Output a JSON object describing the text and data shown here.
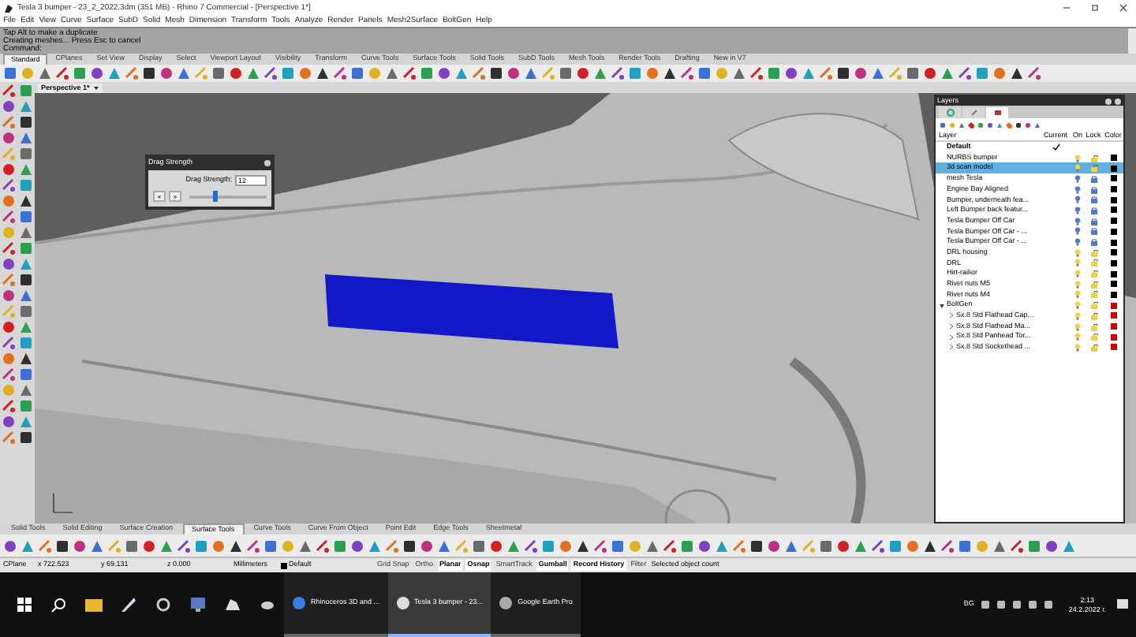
{
  "window": {
    "title": "Tesla 3 bumper - 23_2_2022.3dm (351 MB) - Rhino 7 Commercial - [Perspective 1*]"
  },
  "menu": [
    "File",
    "Edit",
    "View",
    "Curve",
    "Surface",
    "SubD",
    "Solid",
    "Mesh",
    "Dimension",
    "Transform",
    "Tools",
    "Analyze",
    "Render",
    "Panels",
    "Mesh2Surface",
    "BoltGen",
    "Help"
  ],
  "command_history": [
    "Tap Alt to make a duplicate",
    "Creating meshes... Press Esc to cancel",
    "Command:"
  ],
  "top_tabs": [
    {
      "label": "Standard",
      "selected": true
    },
    {
      "label": "CPlanes",
      "selected": false
    },
    {
      "label": "Set View",
      "selected": false
    },
    {
      "label": "Display",
      "selected": false
    },
    {
      "label": "Select",
      "selected": false
    },
    {
      "label": "Viewport Layout",
      "selected": false
    },
    {
      "label": "Visibility",
      "selected": false
    },
    {
      "label": "Transform",
      "selected": false
    },
    {
      "label": "Curve Tools",
      "selected": false
    },
    {
      "label": "Surface Tools",
      "selected": false
    },
    {
      "label": "Solid Tools",
      "selected": false
    },
    {
      "label": "SubD Tools",
      "selected": false
    },
    {
      "label": "Mesh Tools",
      "selected": false
    },
    {
      "label": "Render Tools",
      "selected": false
    },
    {
      "label": "Drafting",
      "selected": false
    },
    {
      "label": "New in V7",
      "selected": false
    }
  ],
  "viewport": {
    "title": "Perspective 1*"
  },
  "drag_dialog": {
    "title": "Drag Strength",
    "label": "Drag Strength:",
    "value": "12",
    "level": 0.3,
    "buttons": [
      "«",
      "»"
    ]
  },
  "layers_panel": {
    "title": "Layers",
    "tabs": [
      {
        "selected": false
      },
      {
        "selected": false
      },
      {
        "selected": true
      }
    ],
    "columns": [
      "Layer",
      "Current",
      "On",
      "Lock",
      "Color"
    ],
    "layers": [
      {
        "name": "Default",
        "current": true,
        "selected": false
      },
      {
        "name": "NURBS bumper",
        "current": false,
        "selected": false,
        "on": true,
        "locked": false,
        "color": "#000000"
      },
      {
        "name": "3d scan model",
        "current": false,
        "selected": true,
        "on": true,
        "locked": false,
        "color": "#000000"
      },
      {
        "name": "mesh Tesla",
        "current": false,
        "selected": false,
        "on": false,
        "locked": true,
        "color": "#000000"
      },
      {
        "name": "Engine Bay Aligned",
        "current": false,
        "selected": false,
        "on": false,
        "locked": true,
        "color": "#000000"
      },
      {
        "name": "Bumper, underneath fea...",
        "current": false,
        "selected": false,
        "on": false,
        "locked": true,
        "color": "#000000"
      },
      {
        "name": "Left Bumper back featur...",
        "current": false,
        "selected": false,
        "on": false,
        "locked": true,
        "color": "#000000"
      },
      {
        "name": "Tesla Bumper Off Car",
        "current": false,
        "selected": false,
        "on": false,
        "locked": true,
        "color": "#000000"
      },
      {
        "name": "Tesla Bumper Off Car - ...",
        "current": false,
        "selected": false,
        "on": false,
        "locked": true,
        "color": "#000000"
      },
      {
        "name": "Tesla Bumper Off Car - ...",
        "current": false,
        "selected": false,
        "on": false,
        "locked": true,
        "color": "#000000"
      },
      {
        "name": "DRL housing",
        "current": false,
        "selected": false,
        "on": true,
        "locked": false,
        "color": "#000000"
      },
      {
        "name": "DRL",
        "current": false,
        "selected": false,
        "on": true,
        "locked": false,
        "color": "#000000"
      },
      {
        "name": "Hirt-railior",
        "current": false,
        "selected": false,
        "on": true,
        "locked": false,
        "color": "#000000"
      },
      {
        "name": "Rivet nuts M5",
        "current": false,
        "selected": false,
        "on": true,
        "locked": false,
        "color": "#000000"
      },
      {
        "name": "Rivet nuts M4",
        "current": false,
        "selected": false,
        "on": true,
        "locked": false,
        "color": "#000000"
      },
      {
        "name": "BoltGen",
        "current": false,
        "selected": false,
        "on": true,
        "locked": false,
        "color": "#d40000",
        "expanded": true,
        "children": [
          {
            "name": "Sx.8 Std Flathead Cap...",
            "current": false,
            "selected": false,
            "on": true,
            "locked": false,
            "color": "#d40000",
            "expanded": false
          },
          {
            "name": "Sx.8 Std Flathead Ma...",
            "current": false,
            "selected": false,
            "on": true,
            "locked": false,
            "color": "#d40000",
            "expanded": false
          },
          {
            "name": "Sx.8 Std Panhead Tor...",
            "current": false,
            "selected": false,
            "on": true,
            "locked": false,
            "color": "#d40000",
            "expanded": false
          },
          {
            "name": "Sx.8 Std Sockethead ...",
            "current": false,
            "selected": false,
            "on": true,
            "locked": false,
            "color": "#d40000",
            "expanded": false
          }
        ]
      }
    ]
  },
  "bottom_tabs": [
    {
      "label": "Solid Tools",
      "selected": false
    },
    {
      "label": "Solid Editing",
      "selected": false
    },
    {
      "label": "Surface Creation",
      "selected": false
    },
    {
      "label": "Surface Tools",
      "selected": true
    },
    {
      "label": "Curve Tools",
      "selected": false
    },
    {
      "label": "Curve From Object",
      "selected": false
    },
    {
      "label": "Point Edit",
      "selected": false
    },
    {
      "label": "Edge Tools",
      "selected": false
    },
    {
      "label": "Sheetmetal",
      "selected": false
    }
  ],
  "status_bar": {
    "cplane": "CPlane",
    "x": "x 722.523",
    "y": "y 69.131",
    "z": "z 0.000",
    "units": "Millimeters",
    "layer": {
      "name": "Default",
      "color": "#000000"
    },
    "toggles": [
      {
        "label": "Grid Snap",
        "on": false
      },
      {
        "label": "Ortho",
        "on": false
      },
      {
        "label": "Planar",
        "on": true
      },
      {
        "label": "Osnap",
        "on": true
      },
      {
        "label": "SmartTrack",
        "on": false
      },
      {
        "label": "Gumball",
        "on": true
      },
      {
        "label": "Record History",
        "on": true
      },
      {
        "label": "Filter",
        "on": false
      }
    ],
    "message": "Selected object count"
  },
  "taskbar": {
    "apps": [
      {
        "label": "Rhinoceros 3D and ...",
        "selected": false
      },
      {
        "label": "Tesla 3 bumper - 23...",
        "selected": true
      },
      {
        "label": "Google Earth Pro",
        "selected": false
      }
    ],
    "language": "BG",
    "time": "2:13",
    "date": "24.2.2022 г."
  }
}
